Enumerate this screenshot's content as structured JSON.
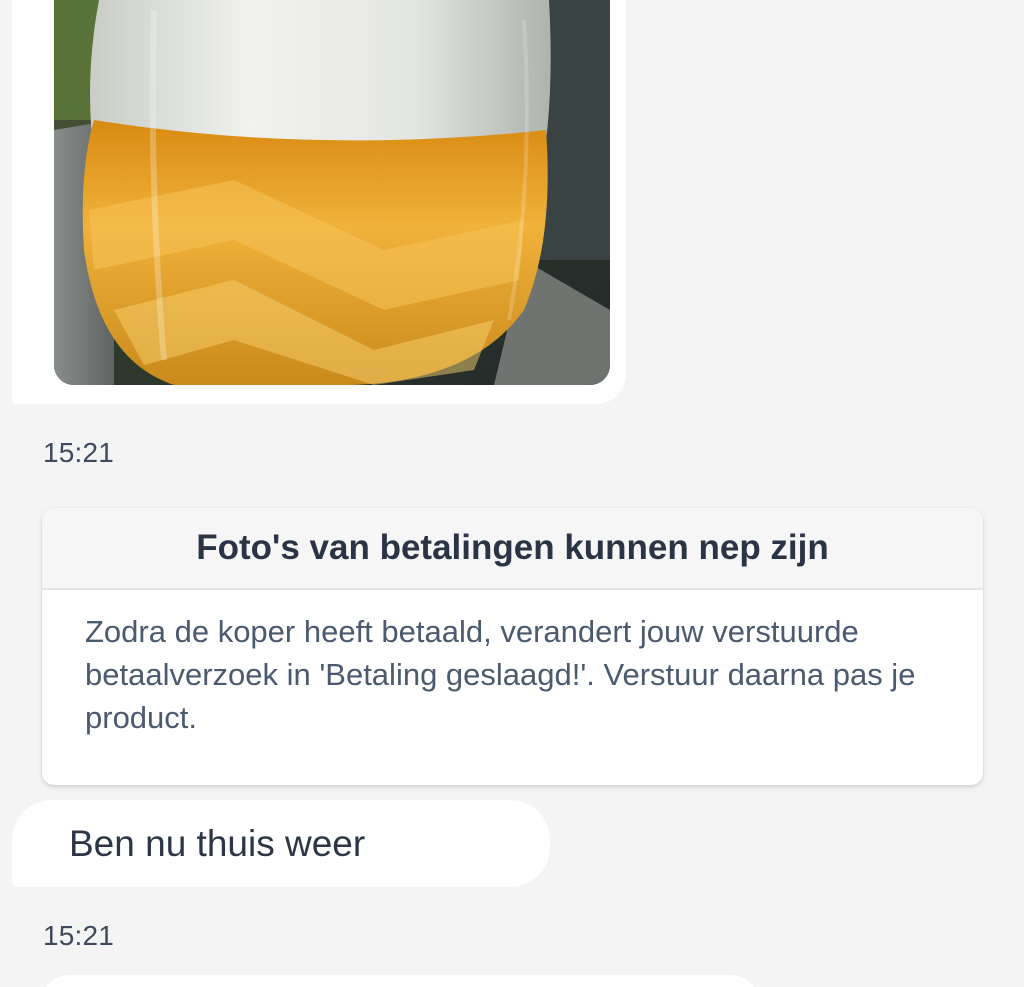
{
  "messages": [
    {
      "type": "image",
      "image_description_icon": "beer-glass-photo"
    },
    {
      "type": "timestamp",
      "time": "15:21"
    },
    {
      "type": "system_warning",
      "title": "Foto's van betalingen kunnen nep zijn",
      "body": "Zodra de koper heeft betaald, verandert jouw verstuurde betaalverzoek in 'Betaling geslaagd!'. Verstuur daarna pas je product."
    },
    {
      "type": "text",
      "text": "Ben nu thuis weer"
    },
    {
      "type": "timestamp",
      "time": "15:21"
    }
  ],
  "colors": {
    "background": "#f4f4f5",
    "bubble": "#ffffff",
    "text_dark": "#2d3646",
    "text_muted": "#4c5a6f"
  }
}
